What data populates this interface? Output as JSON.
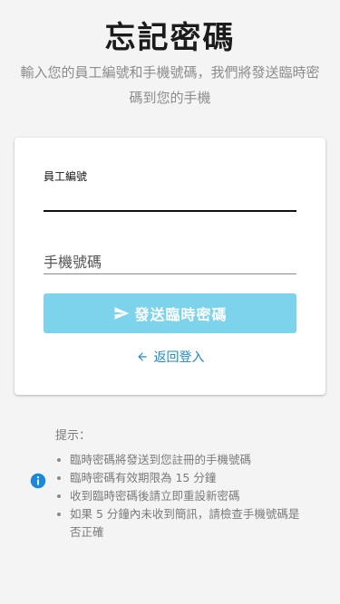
{
  "header": {
    "title": "忘記密碼",
    "subtitle": "輸入您的員工編號和手機號碼，我們將發送臨時密碼到您的手機"
  },
  "form": {
    "employee_id_label": "員工編號",
    "phone_label": "手機號碼",
    "send_button_label": "發送臨時密碼",
    "back_link_label": "返回登入"
  },
  "tips": {
    "title": "提示：",
    "items": [
      "臨時密碼將發送到您註冊的手機號碼",
      "臨時密碼有效期限為 15 分鐘",
      "收到臨時密碼後請立即重設新密碼",
      "如果 5 分鐘內未收到簡訊，請檢查手機號碼是否正確"
    ]
  },
  "icons": {
    "send": "send-icon",
    "back": "arrow-left-icon",
    "info": "info-icon"
  },
  "colors": {
    "accent": "#1e88c8",
    "button_disabled": "#7dd3ec",
    "info": "#1e88d8"
  }
}
